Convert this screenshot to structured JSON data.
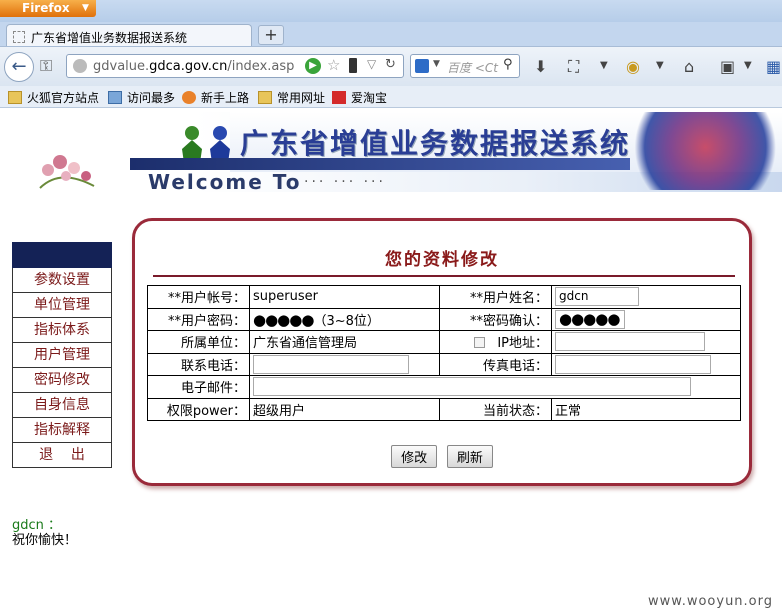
{
  "browser": {
    "app_button": "Firefox",
    "tab_title": "广东省增值业务数据报送系统",
    "url_prefix": "gdvalue.",
    "url_domain": "gdca.gov.cn",
    "url_path": "/index.asp",
    "search_placeholder": "百度 <Ct",
    "bookmarks": [
      "火狐官方站点",
      "访问最多",
      "新手上路",
      "常用网址",
      "爱淘宝"
    ]
  },
  "banner": {
    "title": "广东省增值业务数据报送系统",
    "welcome": "Welcome To",
    "dots": "··· ··· ···"
  },
  "menu": {
    "items": [
      "参数设置",
      "单位管理",
      "指标体系",
      "用户管理",
      "密码修改",
      "自身信息",
      "指标解释",
      "退    出"
    ]
  },
  "form": {
    "title": "您的资料修改",
    "account_label": "**用户帐号：",
    "account_value": "superuser",
    "name_label": "**用户姓名：",
    "name_value": "gdcn",
    "password_label": "**用户密码：",
    "password_value": "●●●●●",
    "password_hint": "（3~8位）",
    "confirm_label": "**密码确认：",
    "confirm_value": "●●●●●",
    "unit_label": "所属单位：",
    "unit_value": "广东省通信管理局",
    "ip_label": "IP地址：",
    "ip_value": "",
    "phone_label": "联系电话：",
    "phone_value": "",
    "fax_label": "传真电话：",
    "fax_value": "",
    "email_label": "电子邮件：",
    "email_value": "",
    "power_label": "权限power：",
    "power_value": "超级用户",
    "status_label": "当前状态：",
    "status_value": "正常",
    "modify_button": "修改",
    "refresh_button": "刷新"
  },
  "footer": {
    "user": "gdcn ：",
    "greeting": "祝你愉快！",
    "watermark": "www.wooyun.org"
  }
}
